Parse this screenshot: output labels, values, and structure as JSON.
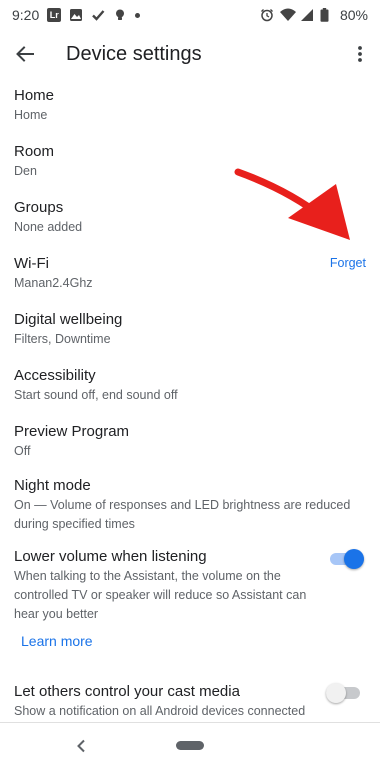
{
  "status_bar": {
    "time": "9:20",
    "icons": [
      "lr-app-icon",
      "photo-icon",
      "check-icon",
      "bulb-icon",
      "dot-icon"
    ],
    "right_icons": [
      "alarm-icon",
      "wifi-icon",
      "signal-icon",
      "battery-icon"
    ],
    "battery": "80%"
  },
  "app_bar": {
    "title": "Device settings",
    "back_icon": "arrow-back-icon",
    "menu_icon": "more-vert-icon"
  },
  "settings": [
    {
      "title": "Home",
      "subtitle": "Home"
    },
    {
      "title": "Room",
      "subtitle": "Den"
    },
    {
      "title": "Groups",
      "subtitle": "None added"
    },
    {
      "title": "Wi-Fi",
      "subtitle": "Manan2.4Ghz",
      "action": "Forget"
    },
    {
      "title": "Digital wellbeing",
      "subtitle": "Filters, Downtime"
    },
    {
      "title": "Accessibility",
      "subtitle": "Start sound off, end sound off"
    },
    {
      "title": "Preview Program",
      "subtitle": "Off"
    },
    {
      "title": "Night mode",
      "subtitle": "On — Volume of responses and LED brightness are reduced during specified times"
    },
    {
      "title": "Lower volume when listening",
      "subtitle": "When talking to the Assistant, the volume on the controlled TV or speaker will reduce so Assistant can hear you better",
      "toggle": "on",
      "link": "Learn more"
    },
    {
      "title": "Let others control your cast media",
      "subtitle": "Show a notification on all Android devices connected",
      "toggle": "off"
    }
  ],
  "colors": {
    "accent": "#1a73e8",
    "annotation": "#e8201c",
    "text_primary": "#202124",
    "text_secondary": "#5f6368"
  },
  "nav_bar": {
    "back_icon": "nav-back-icon",
    "home_icon": "home-pill-icon"
  }
}
